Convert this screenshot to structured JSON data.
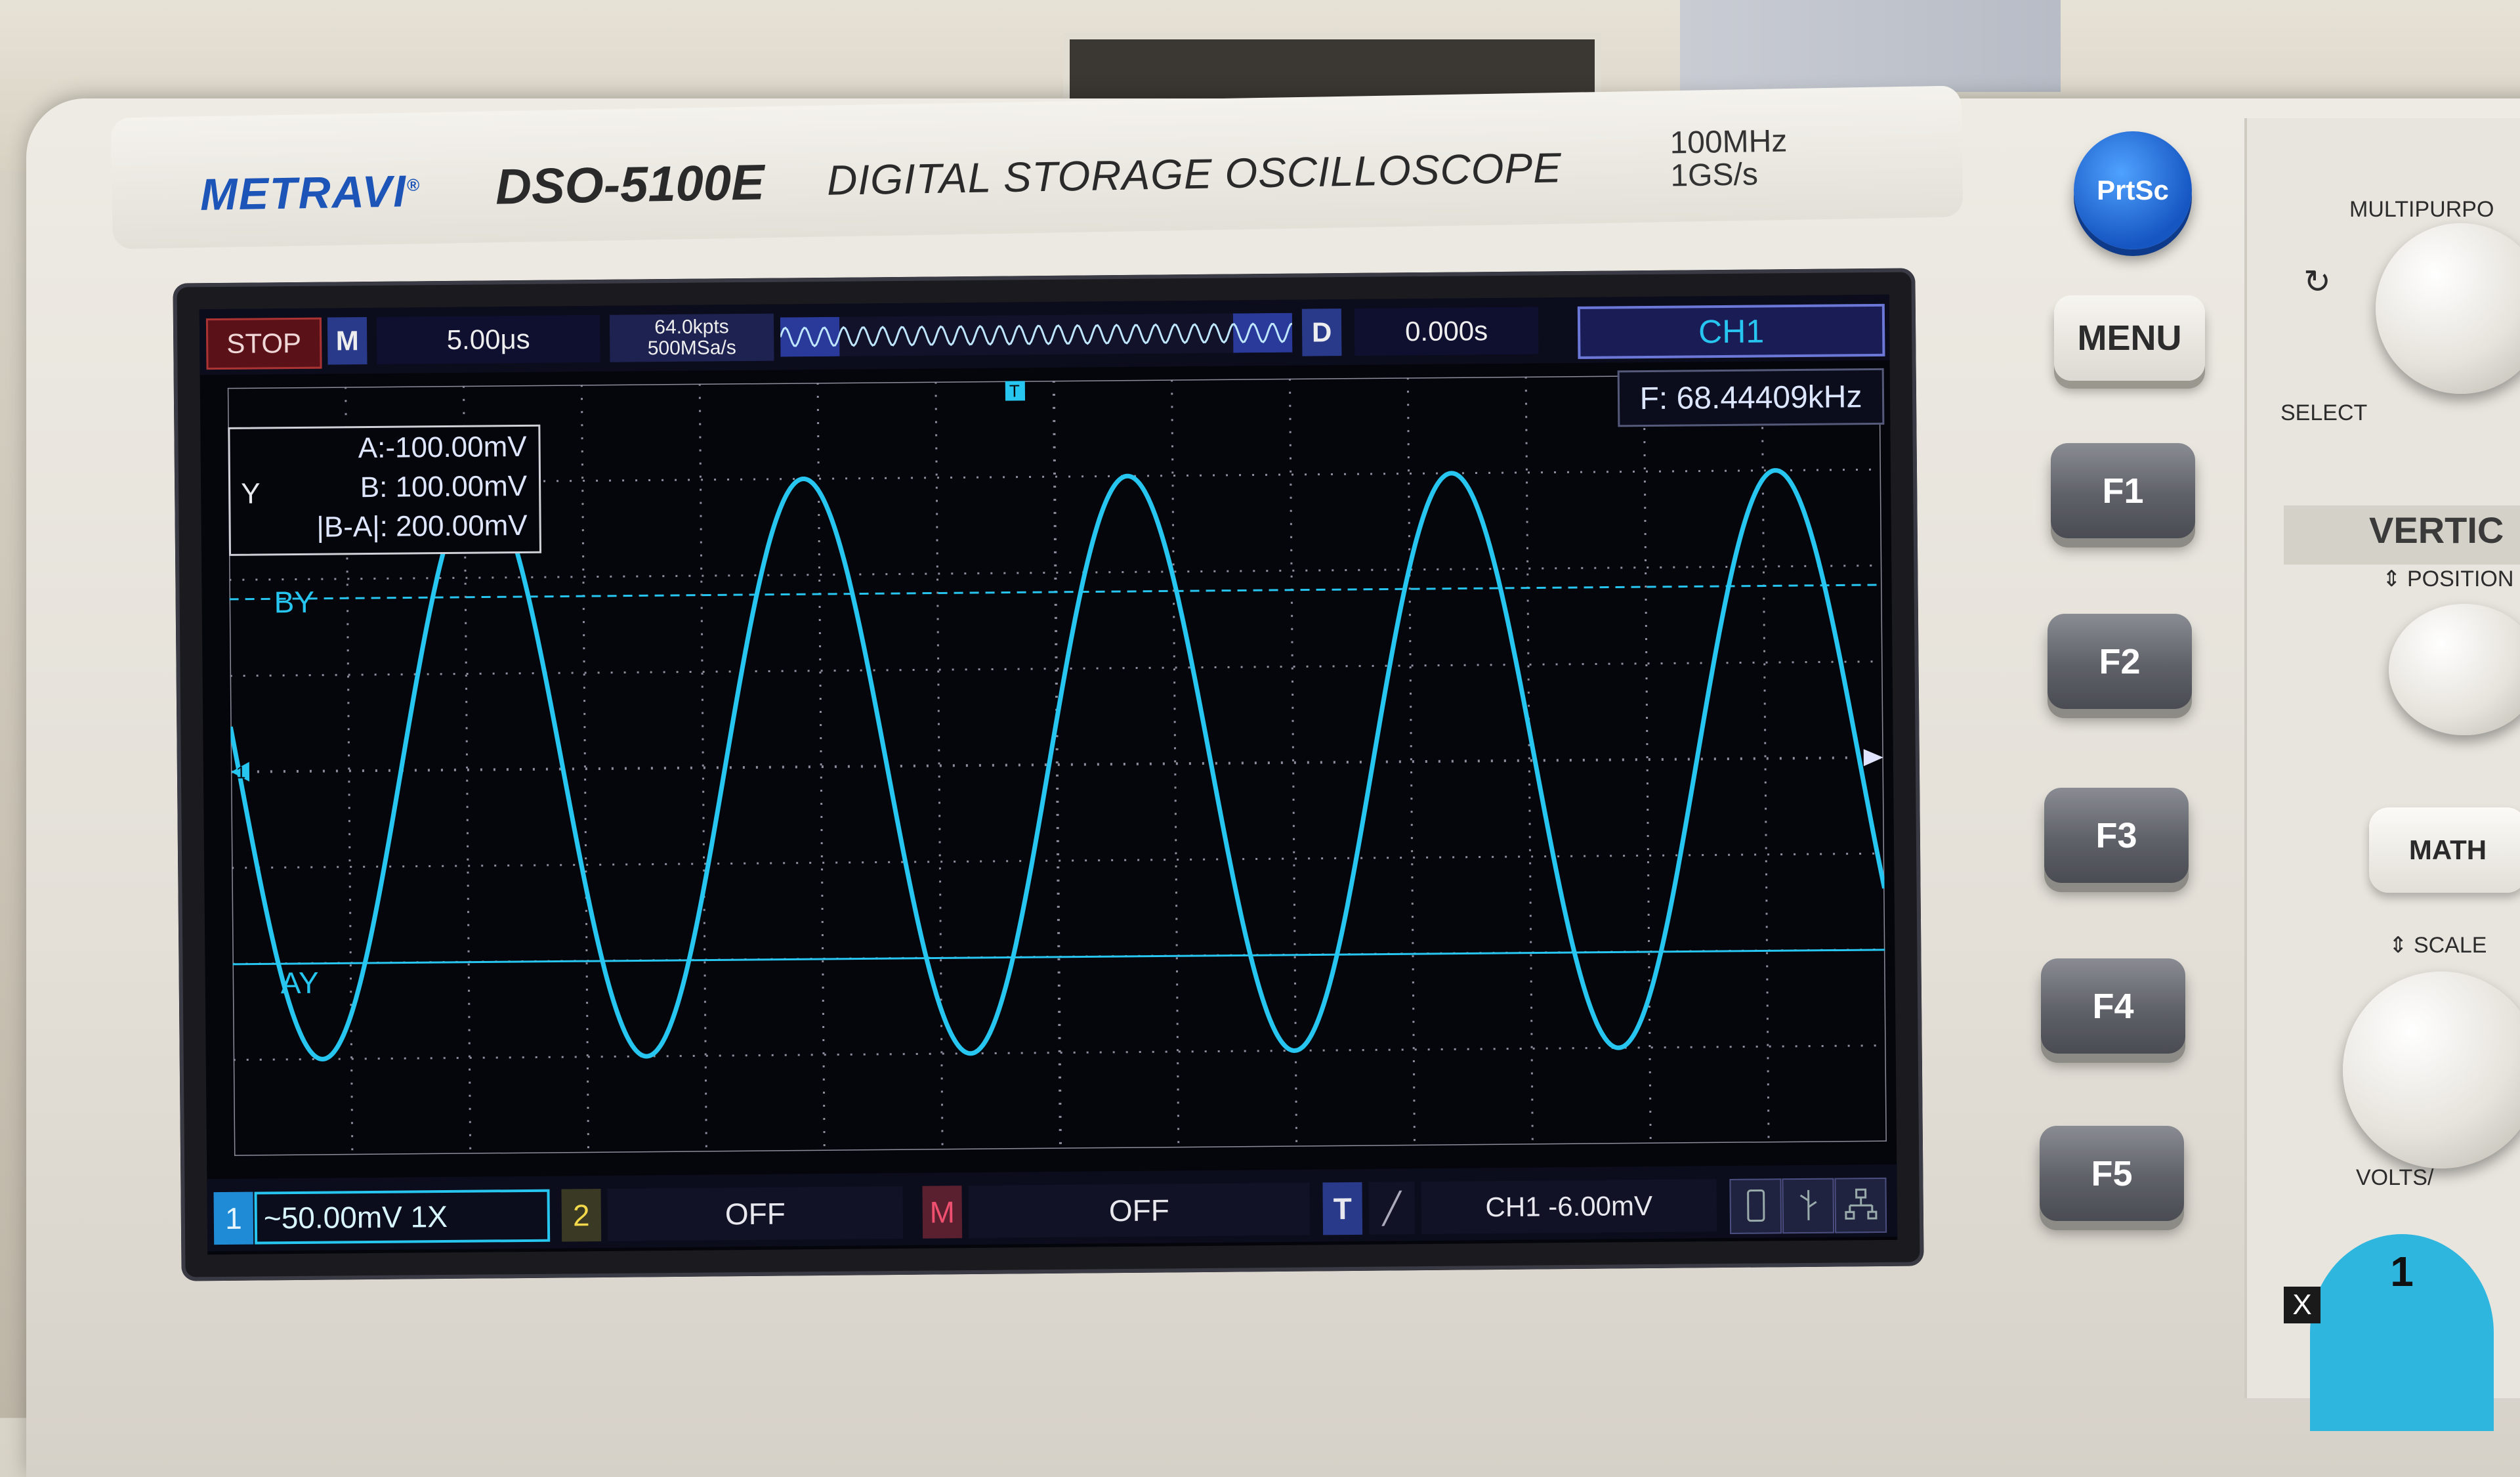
{
  "device": {
    "brand": "METRAVI",
    "brand_mark": "®",
    "model": "DSO-5100E",
    "title": "DIGITAL STORAGE OSCILLOSCOPE",
    "spec_bandwidth": "100MHz",
    "spec_samplerate": "1GS/s"
  },
  "topbar": {
    "run_state": "STOP",
    "menu_tag": "M",
    "timebase": "5.00μs",
    "memory_depth": "64.0kpts",
    "sample_rate": "500MSa/s",
    "delay_tag": "D",
    "trigger_offset": "0.000s",
    "channel": "CH1"
  },
  "measurement": {
    "frequency": "F: 68.44409kHz"
  },
  "cursors": {
    "axis": "Y",
    "a": "A:-100.00mV",
    "b": "B: 100.00mV",
    "delta": "|B-A|: 200.00mV",
    "label_b": "BY",
    "label_a": "AY",
    "level_a_mv": -100,
    "level_b_mv": 100
  },
  "waveform": {
    "color": "#27c6f0",
    "amplitude_mv": 150,
    "cycles_visible": 5.1,
    "volts_per_div_mv": 50
  },
  "markers": {
    "channel_ground": "1",
    "trigger_position": "T"
  },
  "bottombar": {
    "ch1_number": "1",
    "ch1_settings": "~50.00mV  1X",
    "ch2_number": "2",
    "ch2_state": "OFF",
    "math_tag": "M",
    "math_state": "OFF",
    "trigger_tag": "T",
    "trigger_edge": "╱",
    "trigger_settings": "CH1  -6.00mV"
  },
  "controls": {
    "prtsc": "PrtSc",
    "menu": "MENU",
    "softkeys": [
      "F1",
      "F2",
      "F3",
      "F4",
      "F5"
    ],
    "multipurpose": "MULTIPURPO",
    "select": "SELECT",
    "vertical": "VERTIC",
    "position": "POSITION",
    "math": "MATH",
    "scale": "SCALE",
    "volts": "VOLTS/",
    "ch1_button": "1",
    "x_mark": "X"
  }
}
